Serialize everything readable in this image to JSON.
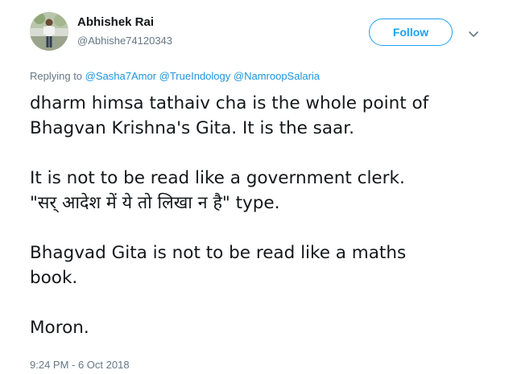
{
  "user": {
    "name": "Abhishek Rai",
    "handle": "@Abhishe74120343",
    "follow_label": "Follow"
  },
  "reply": {
    "prefix": "Replying to",
    "mentions": [
      "@Sasha7Amor",
      "@TrueIndology",
      "@NamroopSalaria"
    ]
  },
  "tweet": {
    "paragraphs": [
      [
        "dharm himsa tathaiv cha is the whole point of",
        "Bhagvan Krishna's Gita. It is the saar."
      ],
      [
        "It is not to be read like a government clerk.",
        "\"सर् आदेश में ये तो लिखा न है\" type."
      ],
      [
        "Bhagvad Gita is not to be read like a maths",
        "book."
      ],
      [
        "Moron."
      ]
    ],
    "timestamp": "9:24 PM - 6 Oct 2018"
  },
  "colors": {
    "accent": "#1da1f2",
    "link": "#1b95e0",
    "muted": "#657786",
    "text": "#14171a"
  },
  "icons": {
    "more": "chevron-down-icon"
  }
}
